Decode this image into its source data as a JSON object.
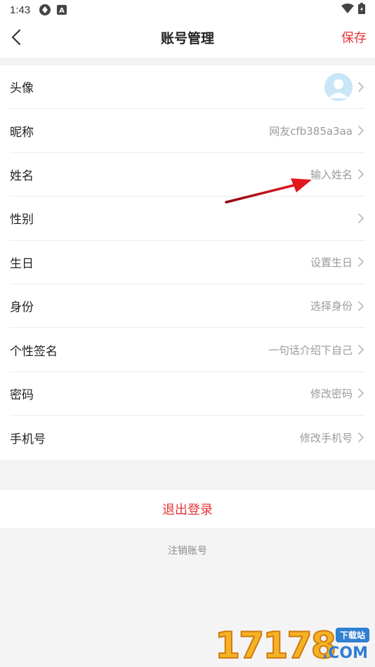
{
  "status_bar": {
    "time": "1:43",
    "icons": [
      "sync-icon",
      "app-a-icon",
      "wifi-icon",
      "battery-icon"
    ]
  },
  "nav": {
    "back_icon": "chevron-left-icon",
    "title": "账号管理",
    "save_label": "保存"
  },
  "settings": {
    "rows": [
      {
        "label": "头像",
        "value": "",
        "has_avatar": true
      },
      {
        "label": "昵称",
        "value": "网友cfb385a3aa"
      },
      {
        "label": "姓名",
        "value": "输入姓名"
      },
      {
        "label": "性别",
        "value": ""
      },
      {
        "label": "生日",
        "value": "设置生日"
      },
      {
        "label": "身份",
        "value": "选择身份"
      },
      {
        "label": "个性签名",
        "value": "一句话介绍下自己"
      },
      {
        "label": "密码",
        "value": "修改密码"
      },
      {
        "label": "手机号",
        "value": "修改手机号"
      }
    ]
  },
  "logout_label": "退出登录",
  "cancel_account_label": "注销账号",
  "watermark": {
    "digits": "17178",
    "badge": "下载站",
    "domain": ".COM"
  },
  "colors": {
    "accent": "#e8343a",
    "value_text": "#9a9a9a",
    "divider": "#ececec",
    "background": "#f4f4f4",
    "annotation_arrow": "#d8141c"
  }
}
